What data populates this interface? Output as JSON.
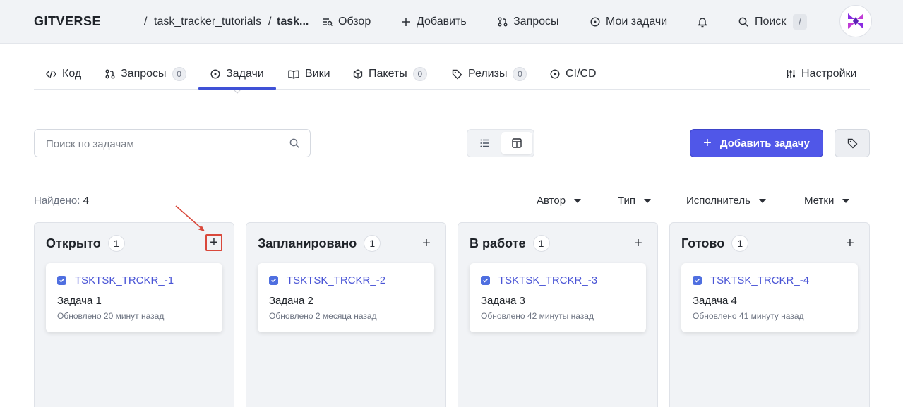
{
  "header": {
    "brand": "GITVERSE",
    "breadcrumb": [
      "task_tracker_tutorials",
      "task..."
    ],
    "separator": "/",
    "nav": [
      {
        "label": "Обзор",
        "icon": "overview-icon"
      },
      {
        "label": "Добавить",
        "icon": "plus-icon"
      },
      {
        "label": "Запросы",
        "icon": "pull-request-icon"
      },
      {
        "label": "Мои задачи",
        "icon": "issue-icon"
      }
    ],
    "notifications_icon": "bell-icon",
    "search_label": "Поиск",
    "search_shortcut": "/"
  },
  "tabs": [
    {
      "label": "Код",
      "icon": "code-icon"
    },
    {
      "label": "Запросы",
      "count": "0",
      "icon": "pull-request-icon"
    },
    {
      "label": "Задачи",
      "icon": "issue-icon",
      "active": true
    },
    {
      "label": "Вики",
      "icon": "book-icon"
    },
    {
      "label": "Пакеты",
      "count": "0",
      "icon": "package-icon"
    },
    {
      "label": "Релизы",
      "count": "0",
      "icon": "tag-icon"
    },
    {
      "label": "CI/CD",
      "icon": "play-icon"
    }
  ],
  "settings_label": "Настройки",
  "toolbar": {
    "search_placeholder": "Поиск по задачам",
    "add_task_label": "Добавить задачу"
  },
  "found": {
    "label": "Найдено:",
    "count": "4"
  },
  "filters": [
    "Автор",
    "Тип",
    "Исполнитель",
    "Метки"
  ],
  "columns": [
    {
      "title": "Открыто",
      "count": "1",
      "card": {
        "id": "TSKTSK_TRCKR_-1",
        "title": "Задача 1",
        "updated": "Обновлено 20 минут назад"
      }
    },
    {
      "title": "Запланировано",
      "count": "1",
      "card": {
        "id": "TSKTSK_TRCKR_-2",
        "title": "Задача 2",
        "updated": "Обновлено 2 месяца назад"
      }
    },
    {
      "title": "В работе",
      "count": "1",
      "card": {
        "id": "TSKTSK_TRCKR_-3",
        "title": "Задача 3",
        "updated": "Обновлено 42 минуты назад"
      }
    },
    {
      "title": "Готово",
      "count": "1",
      "card": {
        "id": "TSKTSK_TRCKR_-4",
        "title": "Задача 4",
        "updated": "Обновлено 41 минуту назад"
      }
    }
  ],
  "colors": {
    "accent": "#5057e8",
    "link": "#4a55d6",
    "highlight": "#d9483b"
  }
}
